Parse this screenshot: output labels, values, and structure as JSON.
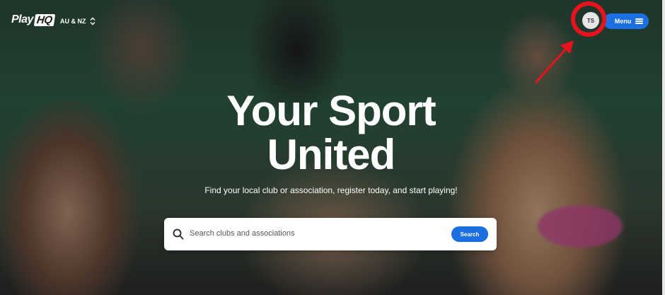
{
  "header": {
    "logo_text": "Play",
    "logo_badge": "HQ",
    "region_label": "AU & NZ",
    "avatar_initials": "TS",
    "menu_label": "Menu"
  },
  "hero": {
    "headline_line1": "Your Sport",
    "headline_line2": "United",
    "subheadline": "Find your local club or association, register today, and start playing!"
  },
  "search": {
    "placeholder": "Search clubs and associations",
    "button_label": "Search"
  },
  "colors": {
    "accent": "#1c6fe0",
    "annotation": "#e8131d"
  },
  "icons": [
    "search-icon",
    "chevron-updown-icon",
    "hamburger-icon",
    "annotation-arrow",
    "annotation-circle"
  ]
}
